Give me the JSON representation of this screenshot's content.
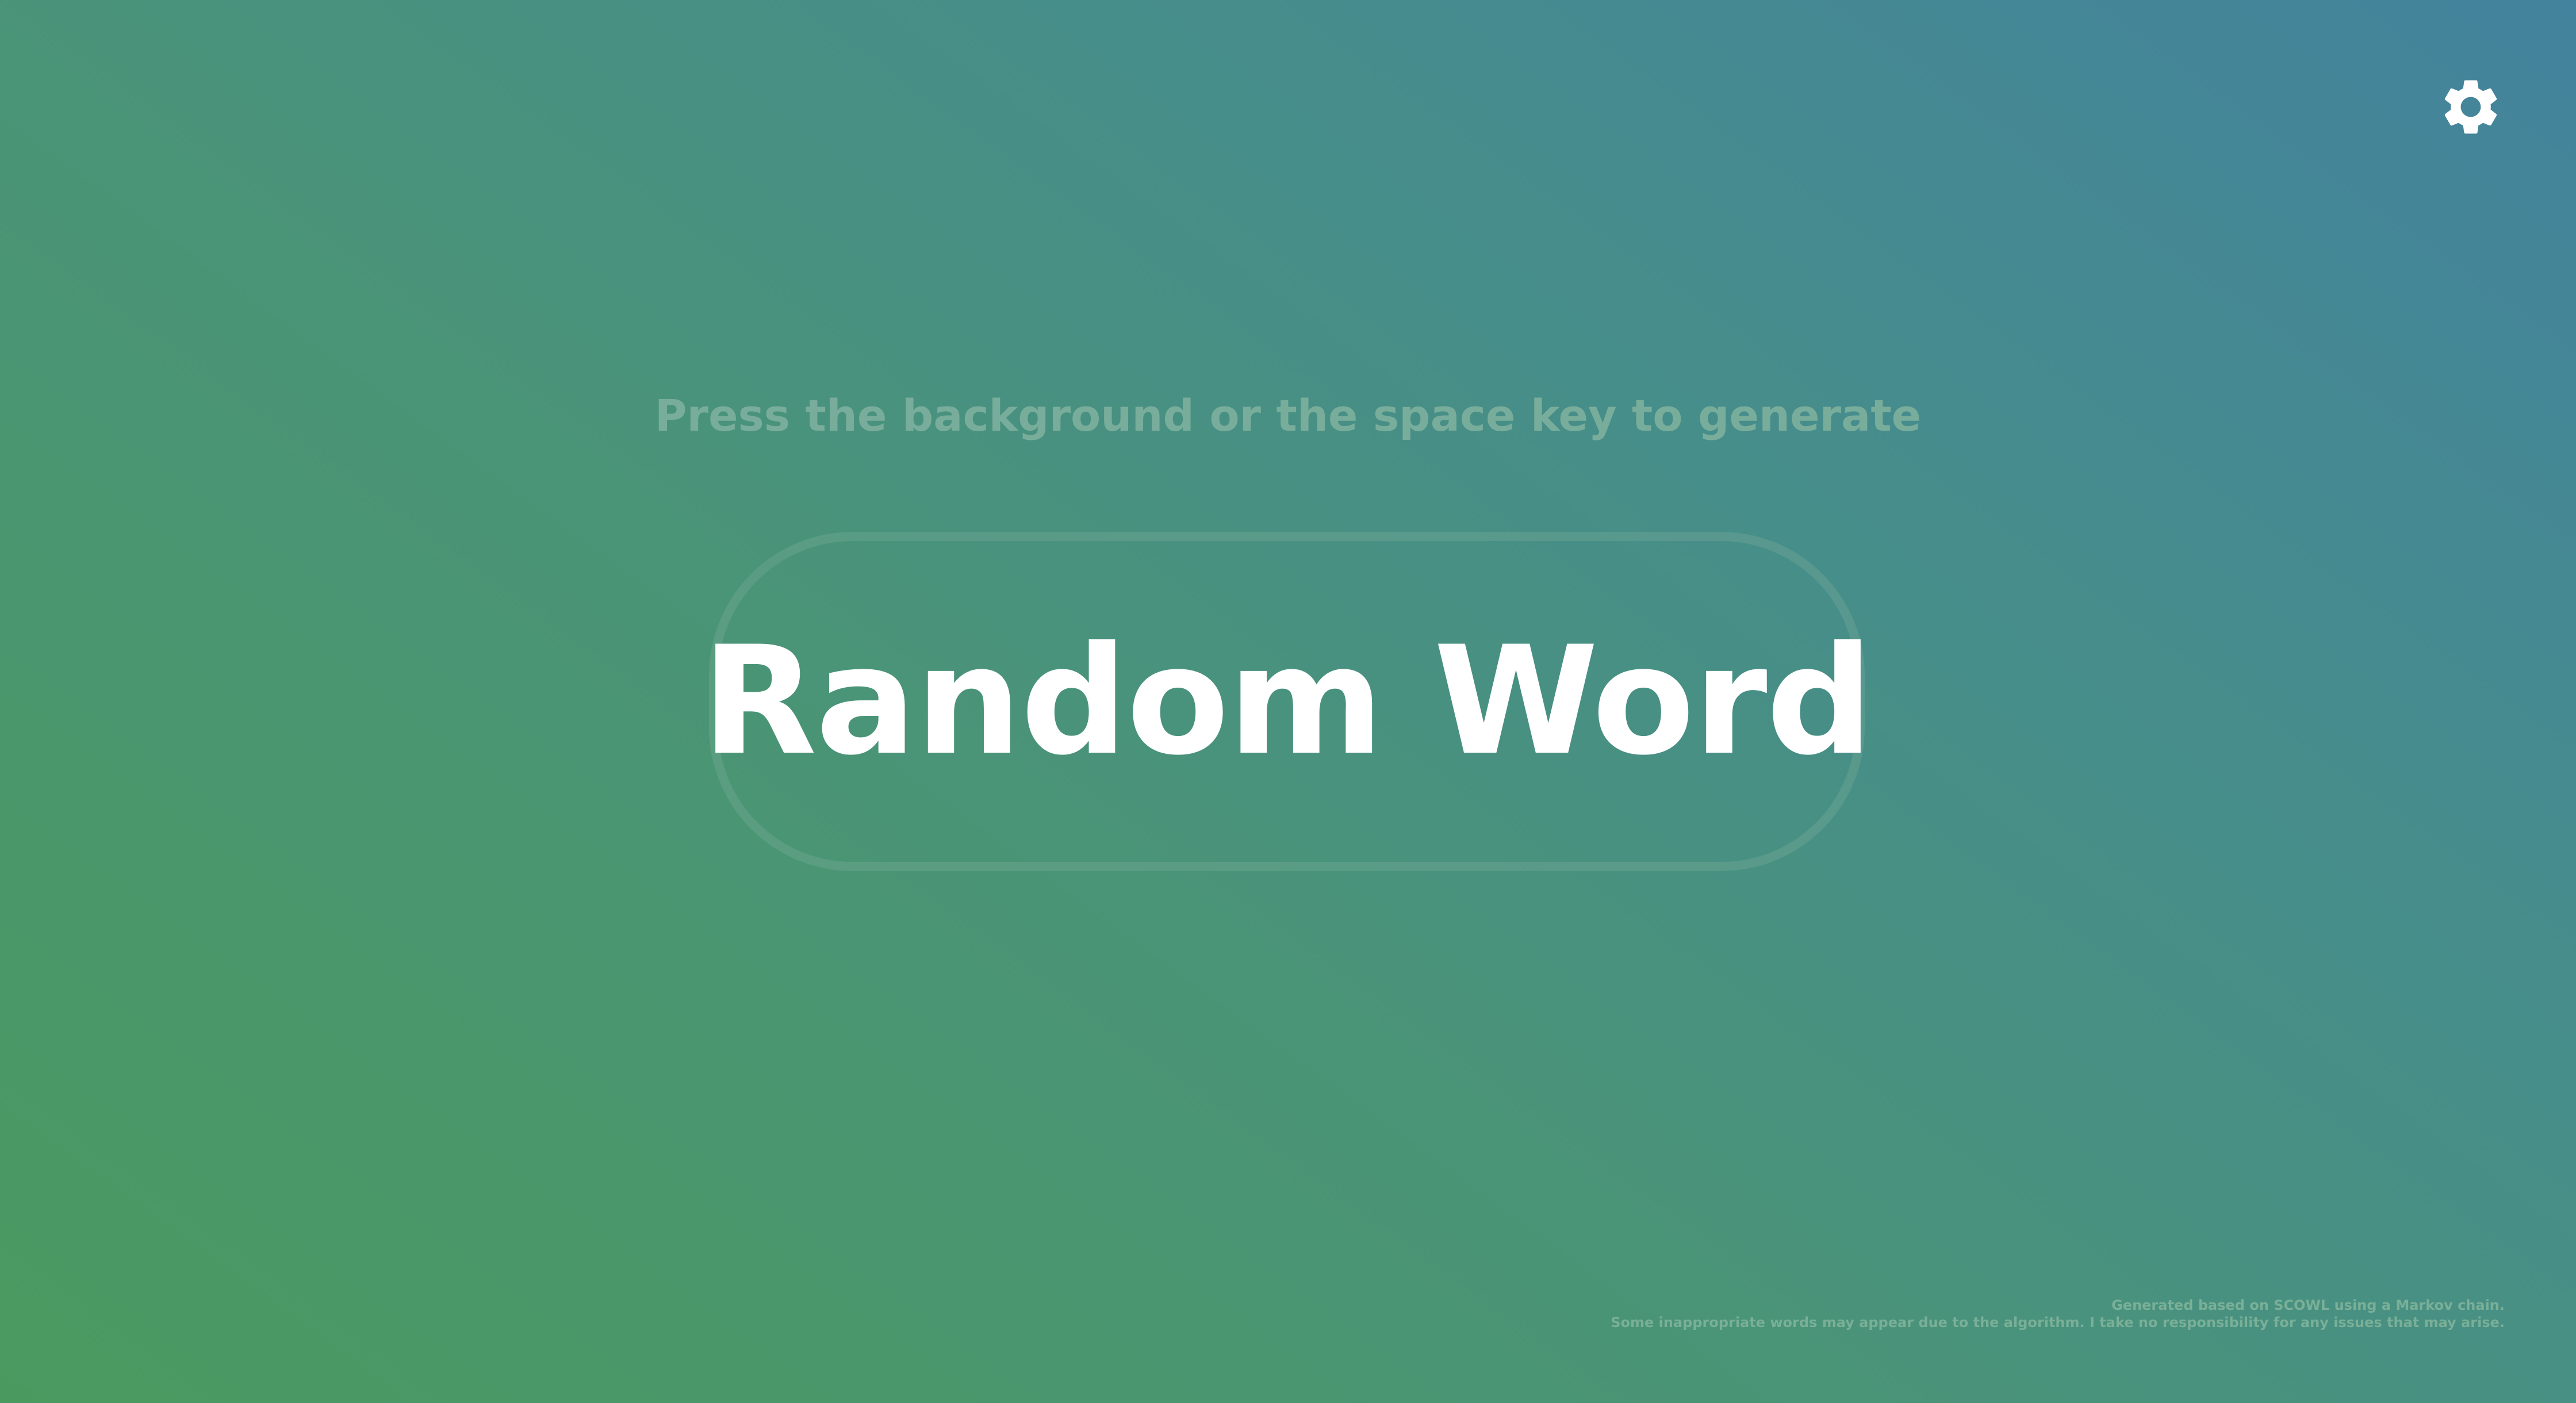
{
  "page": {
    "hint": "Press the background or the space key to generate",
    "word": "Random Word",
    "footer": {
      "line1": "Generated based on SCOWL using a Markov chain.",
      "line2": "Some inappropriate words may appear due to the algorithm. I take no responsibility for any issues that may arise."
    }
  },
  "icons": {
    "settings": "gear-icon"
  },
  "colors": {
    "gradient_start": "#4a9a60",
    "gradient_end": "#43839d",
    "word_text": "#ffffff",
    "hint_text": "#79ad9b"
  }
}
